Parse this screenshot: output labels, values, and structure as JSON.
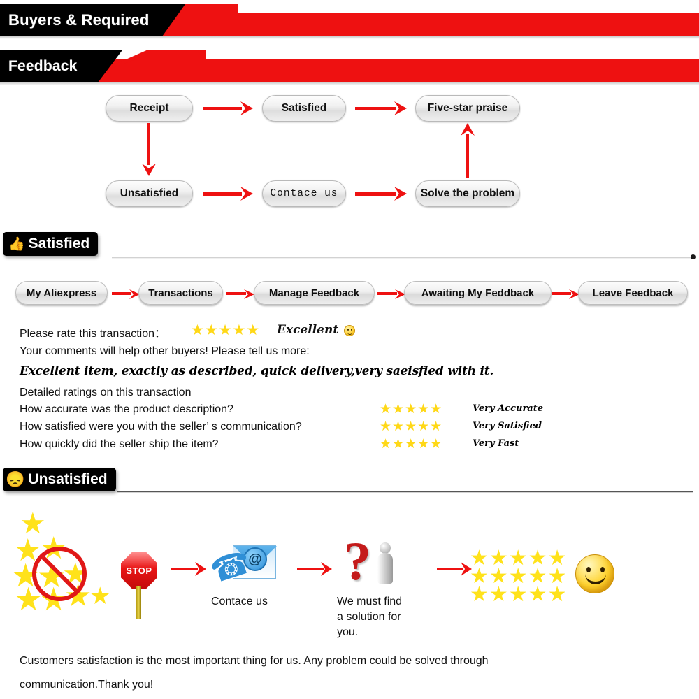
{
  "banners": [
    {
      "id": "buyers-required",
      "label": "Buyers & Required"
    },
    {
      "id": "feedback",
      "label": "Feedback"
    }
  ],
  "flow": {
    "boxes": [
      {
        "id": "receipt",
        "label": "Receipt",
        "mono": false
      },
      {
        "id": "satisfied",
        "label": "Satisfied",
        "mono": false
      },
      {
        "id": "five-star-praise",
        "label": "Five-star praise",
        "mono": false
      },
      {
        "id": "unsatisfied",
        "label": "Unsatisfied",
        "mono": false
      },
      {
        "id": "contace-us",
        "label": "Contace us",
        "mono": true
      },
      {
        "id": "solve-the-problem",
        "label": "Solve the problem",
        "mono": false
      }
    ]
  },
  "satisfied_section": {
    "header": {
      "label": "Satisfied",
      "icon": "thumbs-up-icon",
      "glyph": "👍"
    },
    "breadcrumb": [
      {
        "id": "my-aliexpress",
        "label": "My Aliexpress"
      },
      {
        "id": "transactions",
        "label": "Transactions"
      },
      {
        "id": "manage-feedback",
        "label": "Manage Feedback"
      },
      {
        "id": "awaiting-my-feddback",
        "label": "Awaiting My Feddback"
      },
      {
        "id": "leave-feedback",
        "label": "Leave Feedback"
      }
    ],
    "rate_prompt": "Please rate this transaction：",
    "rate_stars": "★★★★★",
    "rate_word": "Excellent",
    "comments_prompt": "Your comments will help other buyers! Please tell us more:",
    "comment_text": "Excellent item, exactly as described, quick delivery,very saeisfied with it.",
    "detailed_heading": "Detailed ratings on this transaction",
    "detailed_rows": [
      {
        "question": "How accurate was the product description?",
        "stars": "★★★★★",
        "verdict": "Very Accurate"
      },
      {
        "question": "How satisfied were you with the seller’ s communication?",
        "stars": "★★★★★",
        "verdict": "Very Satisfied"
      },
      {
        "question": "How quickly did the seller ship the item?",
        "stars": "★★★★★",
        "verdict": "Very Fast"
      }
    ]
  },
  "unsatisfied_section": {
    "header": {
      "label": "Unsatisfied",
      "icon": "sad-face-icon",
      "glyph": "☹"
    },
    "stop_label": "STOP",
    "contact_label": "Contace us",
    "solution_label": "We must find\na solution for\nyou.",
    "solution_lines": [
      "We must find",
      "a solution for",
      "you."
    ]
  },
  "footer": {
    "line1": "Customers satisfaction is the most important thing for us. Any problem could be solved through",
    "line2": "communication.Thank you!"
  },
  "colors": {
    "red": "#ee1111",
    "black": "#000000",
    "star_gold": "#FFD817",
    "star_bright": "#FFE21A"
  }
}
